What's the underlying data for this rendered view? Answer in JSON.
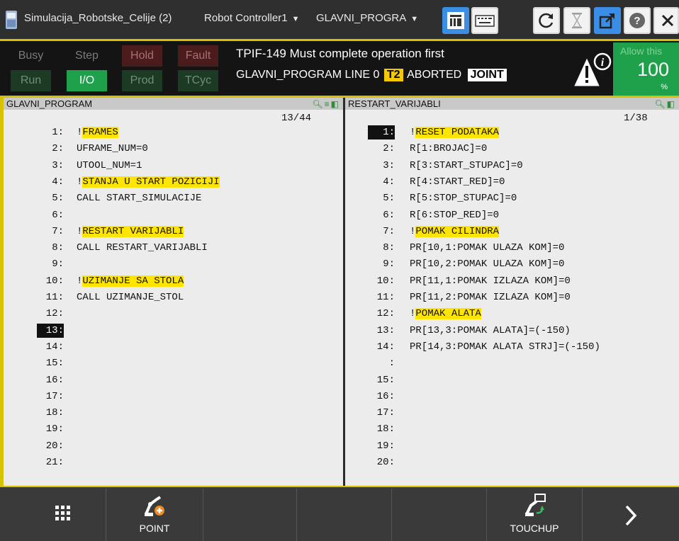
{
  "titlebar": {
    "cell_name": "Simulacija_Robotske_Celije (2)",
    "controller": "Robot Controller1",
    "program": "GLAVNI_PROGRA",
    "icons": [
      "teach-pendant-icon",
      "program-list-icon",
      "keyboard-icon",
      "refresh-icon",
      "wait-icon",
      "external-window-icon",
      "help-icon",
      "close-icon"
    ]
  },
  "status": {
    "leds": [
      {
        "label": "Busy",
        "state": "off"
      },
      {
        "label": "Step",
        "state": "off"
      },
      {
        "label": "Hold",
        "state": "dim-red"
      },
      {
        "label": "Fault",
        "state": "dim-red"
      },
      {
        "label": "Run",
        "state": "dim-green"
      },
      {
        "label": "I/O",
        "state": "on-green"
      },
      {
        "label": "Prod",
        "state": "dim-green"
      },
      {
        "label": "TCyc",
        "state": "dim-green"
      }
    ],
    "message": "TPIF-149 Must complete operation first",
    "program_line": "GLAVNI_PROGRAM LINE 0",
    "mode": "T2",
    "state": "ABORTED",
    "coord": "JOINT",
    "override_hint": "Allow this",
    "override_value": "100",
    "override_unit": "%"
  },
  "left_panel": {
    "title": "GLAVNI_PROGRAM",
    "counter": "13/44",
    "current_line": 13,
    "lines": [
      {
        "num": "1:",
        "prefix": "!",
        "hl": "FRAMES",
        "text": ""
      },
      {
        "num": "2:",
        "prefix": "",
        "hl": "",
        "text": "UFRAME_NUM=0"
      },
      {
        "num": "3:",
        "prefix": "",
        "hl": "",
        "text": "UTOOL_NUM=1"
      },
      {
        "num": "4:",
        "prefix": "!",
        "hl": "STANJA U START POZICIJI",
        "text": ""
      },
      {
        "num": "5:",
        "prefix": "",
        "hl": "",
        "text": "CALL START_SIMULACIJE"
      },
      {
        "num": "6:",
        "prefix": "",
        "hl": "",
        "text": ""
      },
      {
        "num": "7:",
        "prefix": "!",
        "hl": "RESTART VARIJABLI",
        "text": ""
      },
      {
        "num": "8:",
        "prefix": "",
        "hl": "",
        "text": "CALL RESTART_VARIJABLI"
      },
      {
        "num": "9:",
        "prefix": "",
        "hl": "",
        "text": ""
      },
      {
        "num": "10:",
        "prefix": "!",
        "hl": "UZIMANJE SA STOLA",
        "text": ""
      },
      {
        "num": "11:",
        "prefix": "",
        "hl": "",
        "text": "CALL UZIMANJE_STOL"
      },
      {
        "num": "12:",
        "prefix": "",
        "hl": "",
        "text": ""
      },
      {
        "num": "13:",
        "prefix": "",
        "hl": "",
        "text": ""
      },
      {
        "num": "14:",
        "prefix": "",
        "hl": "",
        "text": ""
      },
      {
        "num": "15:",
        "prefix": "",
        "hl": "",
        "text": ""
      },
      {
        "num": "16:",
        "prefix": "",
        "hl": "",
        "text": ""
      },
      {
        "num": "17:",
        "prefix": "",
        "hl": "",
        "text": ""
      },
      {
        "num": "18:",
        "prefix": "",
        "hl": "",
        "text": ""
      },
      {
        "num": "19:",
        "prefix": "",
        "hl": "",
        "text": ""
      },
      {
        "num": "20:",
        "prefix": "",
        "hl": "",
        "text": ""
      },
      {
        "num": "21:",
        "prefix": "",
        "hl": "",
        "text": ""
      }
    ]
  },
  "right_panel": {
    "title": "RESTART_VARIJABLI",
    "counter": "1/38",
    "current_line": 1,
    "lines": [
      {
        "num": "1:",
        "prefix": "!",
        "hl": "RESET PODATAKA",
        "text": ""
      },
      {
        "num": "2:",
        "prefix": "",
        "hl": "",
        "text": "R[1:BROJAC]=0"
      },
      {
        "num": "3:",
        "prefix": "",
        "hl": "",
        "text": "R[3:START_STUPAC]=0"
      },
      {
        "num": "4:",
        "prefix": "",
        "hl": "",
        "text": "R[4:START_RED]=0"
      },
      {
        "num": "5:",
        "prefix": "",
        "hl": "",
        "text": "R[5:STOP_STUPAC]=0"
      },
      {
        "num": "6:",
        "prefix": "",
        "hl": "",
        "text": "R[6:STOP_RED]=0"
      },
      {
        "num": "7:",
        "prefix": "!",
        "hl": "POMAK CILINDRA",
        "text": ""
      },
      {
        "num": "8:",
        "prefix": "",
        "hl": "",
        "text": "PR[10,1:POMAK ULAZA KOM]=0"
      },
      {
        "num": "9:",
        "prefix": "",
        "hl": "",
        "text": "PR[10,2:POMAK ULAZA KOM]=0"
      },
      {
        "num": "10:",
        "prefix": "",
        "hl": "",
        "text": "PR[11,1:POMAK IZLAZA KOM]=0"
      },
      {
        "num": "11:",
        "prefix": "",
        "hl": "",
        "text": "PR[11,2:POMAK IZLAZA KOM]=0"
      },
      {
        "num": "12:",
        "prefix": "!",
        "hl": "POMAK ALATA",
        "text": ""
      },
      {
        "num": "13:",
        "prefix": "",
        "hl": "",
        "text": "PR[13,3:POMAK ALATA]=(-150)"
      },
      {
        "num": "14:",
        "prefix": "",
        "hl": "",
        "text": "PR[14,3:POMAK ALATA STRJ]=(-150)"
      },
      {
        "num": ":",
        "prefix": "",
        "hl": "",
        "text": ""
      },
      {
        "num": "15:",
        "prefix": "",
        "hl": "",
        "text": ""
      },
      {
        "num": "16:",
        "prefix": "",
        "hl": "",
        "text": ""
      },
      {
        "num": "17:",
        "prefix": "",
        "hl": "",
        "text": ""
      },
      {
        "num": "18:",
        "prefix": "",
        "hl": "",
        "text": ""
      },
      {
        "num": "19:",
        "prefix": "",
        "hl": "",
        "text": ""
      },
      {
        "num": "20:",
        "prefix": "",
        "hl": "",
        "text": ""
      }
    ]
  },
  "function_keys": [
    {
      "label": "",
      "icon": "grid-menu-icon"
    },
    {
      "label": "POINT",
      "icon": "robot-point-add-icon"
    },
    {
      "label": "",
      "icon": ""
    },
    {
      "label": "",
      "icon": ""
    },
    {
      "label": "",
      "icon": ""
    },
    {
      "label": "TOUCHUP",
      "icon": "robot-touchup-icon"
    },
    {
      "label": "",
      "icon": "chevron-right-icon"
    }
  ]
}
